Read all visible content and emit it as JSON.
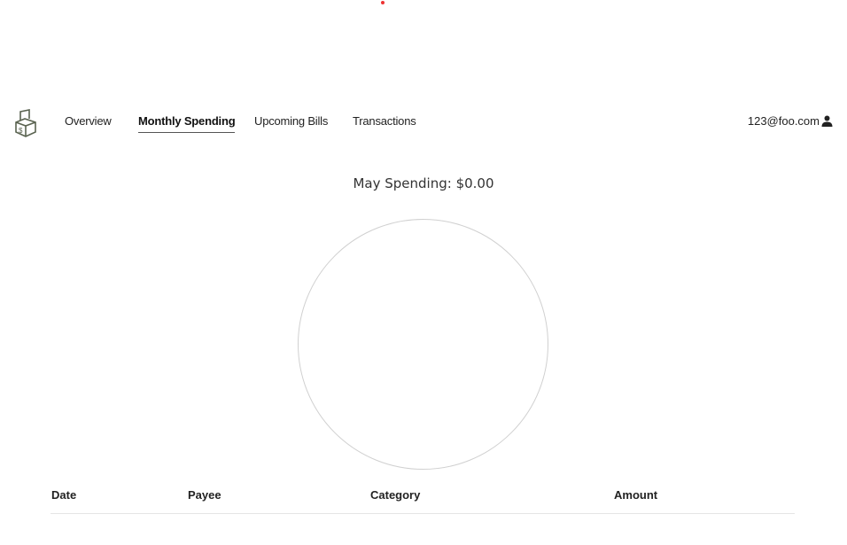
{
  "nav": {
    "tabs": [
      {
        "label": "Overview"
      },
      {
        "label": "Monthly Spending"
      },
      {
        "label": "Upcoming Bills"
      },
      {
        "label": "Transactions"
      }
    ],
    "active": "Monthly Spending",
    "user_email": "123@foo.com"
  },
  "main": {
    "title": "May Spending: $0.00"
  },
  "table": {
    "headers": [
      "Date",
      "Payee",
      "Category",
      "Amount"
    ],
    "rows": []
  },
  "colors": {
    "logo": "#5a6350",
    "pie_outline": "#d0d0d0"
  }
}
